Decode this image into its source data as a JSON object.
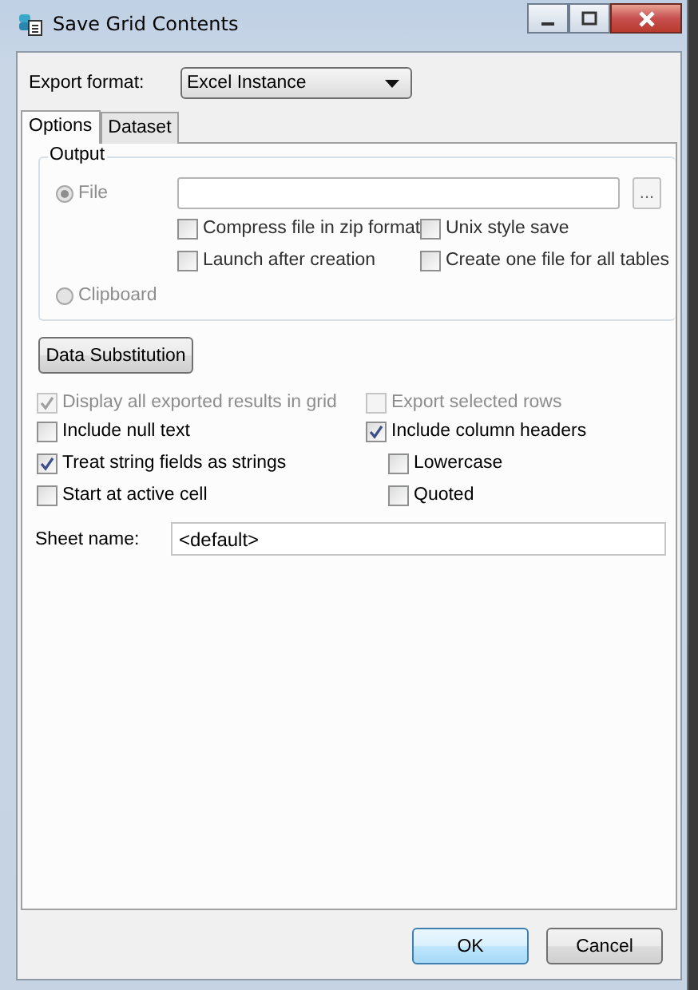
{
  "window": {
    "title": "Save Grid Contents"
  },
  "export_format": {
    "label": "Export format:",
    "value": "Excel Instance"
  },
  "tabs": [
    {
      "label": "Options",
      "selected": true
    },
    {
      "label": "Dataset",
      "selected": false
    }
  ],
  "output": {
    "legend": "Output",
    "file_radio": {
      "label": "File",
      "selected": true,
      "disabled": true
    },
    "browse_button": "...",
    "file_options": [
      {
        "label": "Compress file in zip format",
        "checked": false
      },
      {
        "label": "Unix style save",
        "checked": false
      },
      {
        "label": "Launch after creation",
        "checked": false
      },
      {
        "label": "Create one file for all tables",
        "checked": false
      }
    ],
    "clipboard_radio": {
      "label": "Clipboard",
      "selected": false,
      "disabled": true
    }
  },
  "data_substitution_button": "Data Substitution",
  "left_options": [
    {
      "label": "Display all exported results in grid",
      "checked": true,
      "disabled": true
    },
    {
      "label": "Include null text",
      "checked": false,
      "disabled": false
    },
    {
      "label": "Treat string fields as strings",
      "checked": true,
      "disabled": false
    },
    {
      "label": "Start at active cell",
      "checked": false,
      "disabled": false
    }
  ],
  "right_options": [
    {
      "label": "Export selected rows",
      "checked": false,
      "disabled": true
    },
    {
      "label": "Include column headers",
      "checked": true,
      "disabled": false,
      "children": [
        {
          "label": "Lowercase",
          "checked": false,
          "disabled": false
        },
        {
          "label": "Quoted",
          "checked": false,
          "disabled": false
        }
      ]
    }
  ],
  "sheet_name": {
    "label": "Sheet name:",
    "value": "<default>"
  },
  "buttons": [
    {
      "label": "OK",
      "default": true
    },
    {
      "label": "Cancel",
      "default": false
    }
  ]
}
